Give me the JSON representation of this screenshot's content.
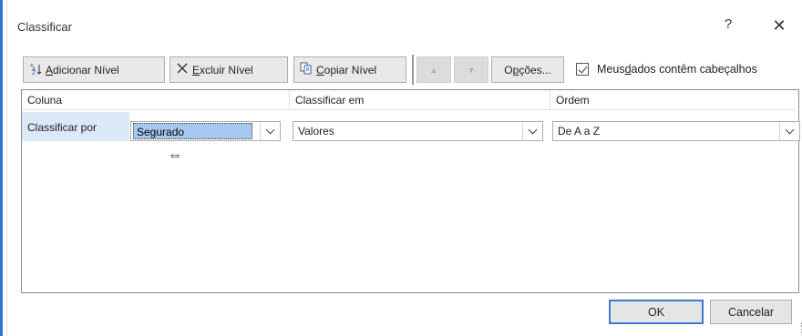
{
  "window": {
    "title": "Classificar",
    "help": "?",
    "close": "✕"
  },
  "toolbar": {
    "add_level": {
      "mnemonic": "A",
      "rest": "dicionar Nível"
    },
    "delete_level": {
      "mnemonic": "E",
      "rest": "xcluir Nível"
    },
    "copy_level": {
      "mnemonic": "C",
      "rest": "opiar Nível"
    },
    "move_up": "▲",
    "move_down": "▼",
    "options": {
      "mnemonic": "p",
      "pre": "O",
      "rest": "ções..."
    },
    "headers_checkbox": {
      "pre": "Meus ",
      "mnemonic": "d",
      "rest": "ados contêm cabeçalhos",
      "checked": true
    }
  },
  "grid": {
    "headers": [
      "Coluna",
      "Classificar em",
      "Ordem"
    ],
    "rows": [
      {
        "label": "Classificar por",
        "column": "Segurado",
        "sort_on": "Valores",
        "order": "De A a Z"
      }
    ]
  },
  "footer": {
    "ok": "OK",
    "cancel": "Cancelar"
  },
  "icons": {
    "cursor": "⇔"
  },
  "colors": {
    "accent": "#3b7bd4",
    "selection": "#a6c8ef",
    "row_label_bg": "#dbe8f7"
  }
}
